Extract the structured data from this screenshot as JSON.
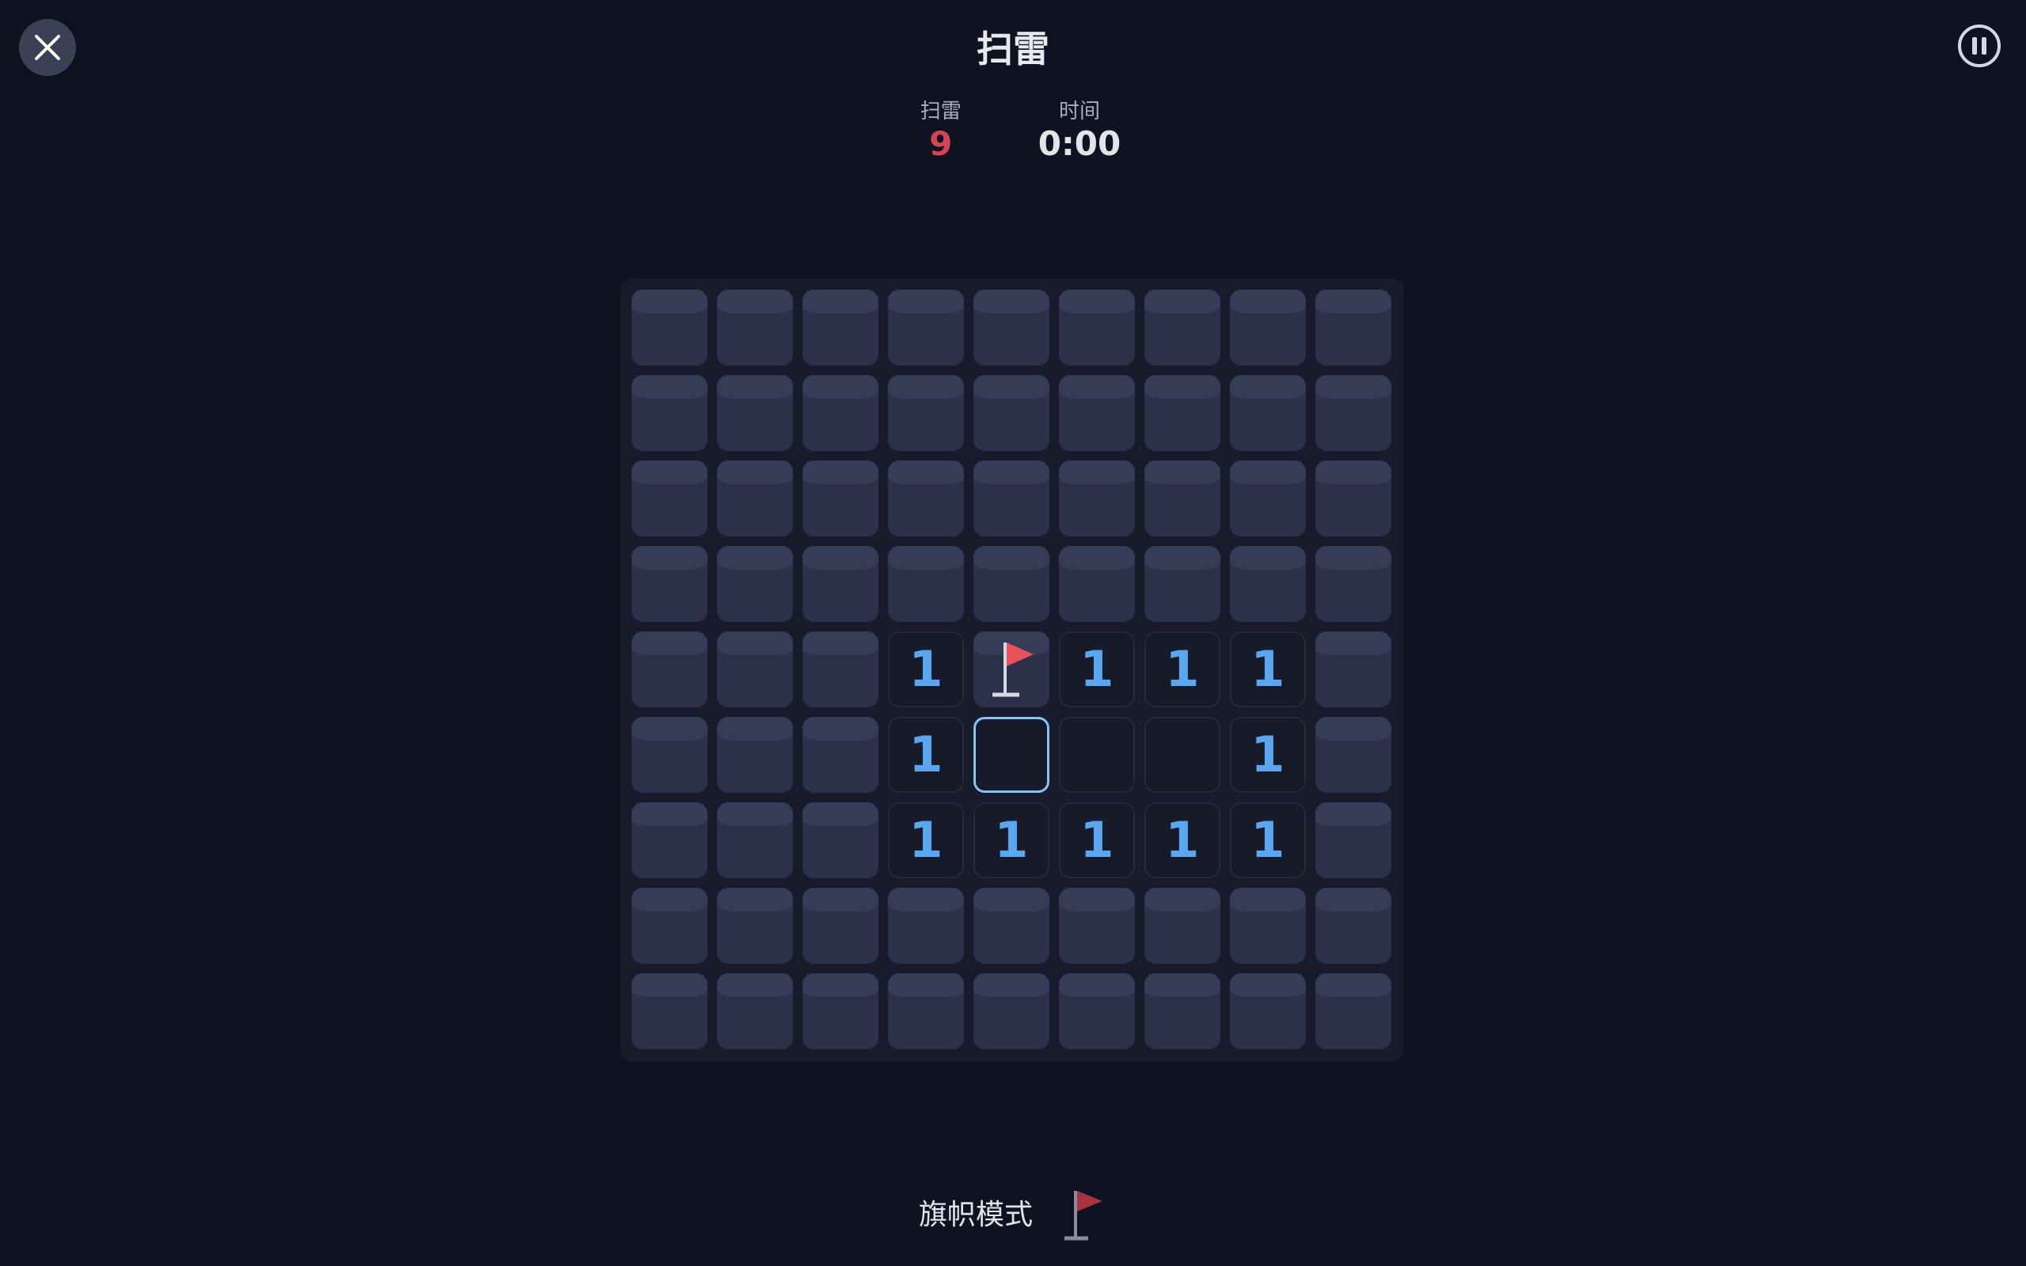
{
  "header": {
    "title": "扫雷"
  },
  "stats": {
    "mines_label": "扫雷",
    "mines_value": "9",
    "time_label": "时间",
    "time_value": "0:00"
  },
  "board": {
    "rows": 9,
    "cols": 9,
    "cells": [
      [
        "H",
        "H",
        "H",
        "H",
        "H",
        "H",
        "H",
        "H",
        "H"
      ],
      [
        "H",
        "H",
        "H",
        "H",
        "H",
        "H",
        "H",
        "H",
        "H"
      ],
      [
        "H",
        "H",
        "H",
        "H",
        "H",
        "H",
        "H",
        "H",
        "H"
      ],
      [
        "H",
        "H",
        "H",
        "H",
        "H",
        "H",
        "H",
        "H",
        "H"
      ],
      [
        "H",
        "H",
        "H",
        "1",
        "F",
        "1",
        "1",
        "1",
        "H"
      ],
      [
        "H",
        "H",
        "H",
        "1",
        "S",
        "0",
        "0",
        "1",
        "H"
      ],
      [
        "H",
        "H",
        "H",
        "1",
        "1",
        "1",
        "1",
        "1",
        "H"
      ],
      [
        "H",
        "H",
        "H",
        "H",
        "H",
        "H",
        "H",
        "H",
        "H"
      ],
      [
        "H",
        "H",
        "H",
        "H",
        "H",
        "H",
        "H",
        "H",
        "H"
      ]
    ]
  },
  "footer": {
    "flag_mode_label": "旗帜模式"
  },
  "icons": {
    "close": "close-icon",
    "pause": "pause-icon",
    "flag": "flag-icon"
  },
  "colors": {
    "background": "#0f1220",
    "board": "#171b2b",
    "hidden_cell": "#2a3148",
    "number": "#59a7f0",
    "mine_counter": "#d54455",
    "flag_red": "#e8505b",
    "flag_mode_red": "#a8323e",
    "selected_border": "#86c4f2"
  }
}
